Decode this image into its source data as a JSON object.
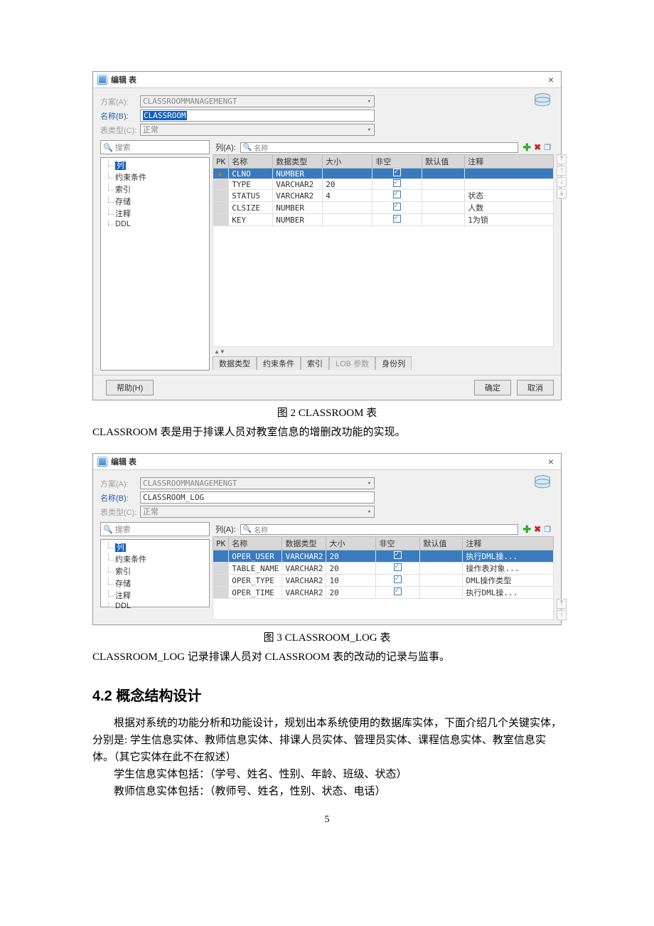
{
  "dialog1": {
    "title": "编辑 表",
    "scheme_label": "方案(A):",
    "scheme_value": "CLASSROOMMANAGEMENGT",
    "name_label": "名称(B):",
    "name_value": "CLASSROOM",
    "type_label": "表类型(C):",
    "type_value": "正常",
    "search_placeholder": "搜索",
    "tree": [
      "列",
      "约束条件",
      "索引",
      "存储",
      "注释",
      "DDL"
    ],
    "cols_label": "列(A):",
    "cols_search": "名称",
    "grid_headers": [
      "PK",
      "名称",
      "数据类型",
      "大小",
      "非空",
      "默认值",
      "注释"
    ],
    "rows": [
      {
        "pk": true,
        "name": "CLNO",
        "dtype": "NUMBER",
        "size": "",
        "notnull": true,
        "def": "",
        "comment": ""
      },
      {
        "pk": false,
        "name": "TYPE",
        "dtype": "VARCHAR2",
        "size": "20",
        "notnull": true,
        "def": "",
        "comment": ""
      },
      {
        "pk": false,
        "name": "STATUS",
        "dtype": "VARCHAR2",
        "size": "4",
        "notnull": true,
        "def": "",
        "comment": "状态"
      },
      {
        "pk": false,
        "name": "CLSIZE",
        "dtype": "NUMBER",
        "size": "",
        "notnull": true,
        "def": "",
        "comment": "人数"
      },
      {
        "pk": false,
        "name": "KEY",
        "dtype": "NUMBER",
        "size": "",
        "notnull": true,
        "def": "",
        "comment": "1为锁"
      }
    ],
    "tabs": [
      "数据类型",
      "约束条件",
      "索引",
      "LOB 参数",
      "身份列"
    ],
    "help": "帮助(H)",
    "ok": "确定",
    "cancel": "取消"
  },
  "caption1": "图 2 CLASSROOM 表",
  "text1": "CLASSROOM 表是用于排课人员对教室信息的增删改功能的实现。",
  "dialog2": {
    "title": "编辑 表",
    "scheme_label": "方案(A):",
    "scheme_value": "CLASSROOMMANAGEMENGT",
    "name_label": "名称(B):",
    "name_value": "CLASSROOM_LOG",
    "type_label": "表类型(C):",
    "type_value": "正常",
    "search_placeholder": "搜索",
    "tree": [
      "列",
      "约束条件",
      "索引",
      "存储",
      "注释",
      "DDL"
    ],
    "cols_label": "列(A):",
    "cols_search": "名称",
    "grid_headers": [
      "PK",
      "名称",
      "数据类型",
      "大小",
      "非空",
      "默认值",
      "注释"
    ],
    "rows": [
      {
        "pk": false,
        "name": "OPER_USER",
        "dtype": "VARCHAR2",
        "size": "20",
        "notnull": true,
        "def": "",
        "comment": "执行DML操..."
      },
      {
        "pk": false,
        "name": "TABLE_NAME",
        "dtype": "VARCHAR2",
        "size": "20",
        "notnull": true,
        "def": "",
        "comment": "操作表对象..."
      },
      {
        "pk": false,
        "name": "OPER_TYPE",
        "dtype": "VARCHAR2",
        "size": "10",
        "notnull": true,
        "def": "",
        "comment": "DML操作类型"
      },
      {
        "pk": false,
        "name": "OPER_TIME",
        "dtype": "VARCHAR2",
        "size": "20",
        "notnull": true,
        "def": "",
        "comment": "执行DML操..."
      }
    ]
  },
  "caption2": "图 3 CLASSROOM_LOG 表",
  "text2": "CLASSROOM_LOG 记录排课人员对 CLASSROOM 表的改动的记录与监事。",
  "section_heading": "4.2 概念结构设计",
  "para1": "根据对系统的功能分析和功能设计，规划出本系统使用的数据库实体，下面介绍几个关键实体，分别是: 学生信息实体、教师信息实体、排课人员实体、管理员实体、课程信息实体、教室信息实体。（其它实体在此不在叙述）",
  "para2": "学生信息实体包括：（学号、姓名、性别、年龄、班级、状态）",
  "para3": "教师信息实体包括：（教师号、姓名，性别、状态、电话）",
  "page_num": "5"
}
